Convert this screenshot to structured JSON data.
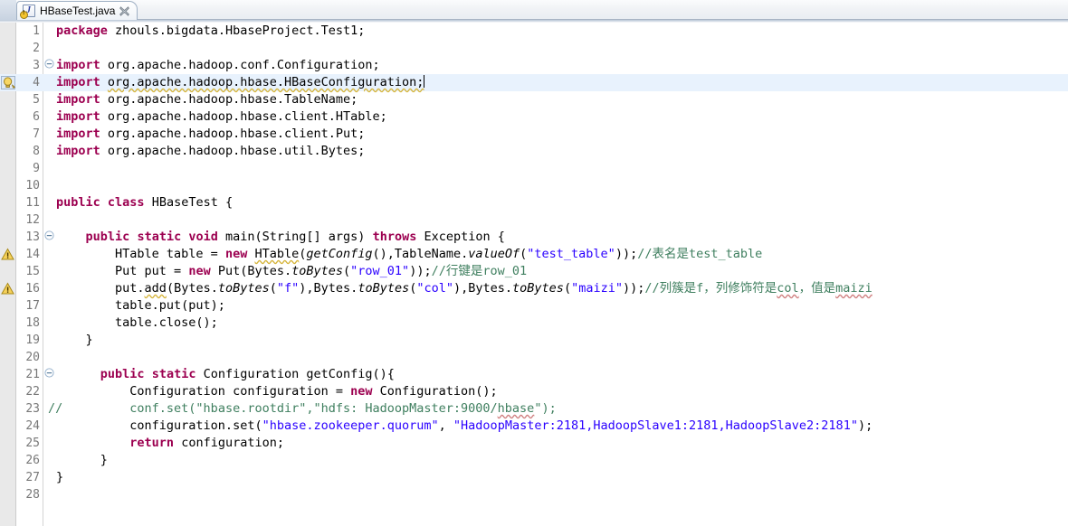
{
  "window": {
    "app": "Eclipse IDE - Java Editor"
  },
  "tab": {
    "label": "HBaseTest.java",
    "icon": "java-file-icon",
    "close_icon": "close-icon",
    "warning_badge": "warning-badge-icon"
  },
  "editor": {
    "current_line": 4,
    "colors": {
      "keyword": "#9c0050",
      "string": "#2a00ff",
      "comment": "#3f7f5f",
      "current_line_highlight": "#e8f2fd",
      "gutter": "#e9e9e9",
      "line_number": "#787878",
      "background": "#ffffff"
    },
    "lines": [
      {
        "no": "1",
        "fold": "",
        "marker": "",
        "html": "<span class=\"kw\">package</span> zhouls.bigdata.HbaseProject.Test1;"
      },
      {
        "no": "2",
        "fold": "",
        "marker": "",
        "html": ""
      },
      {
        "no": "3",
        "fold": "minus",
        "marker": "",
        "html": "<span class=\"kw\">import</span> org.apache.hadoop.conf.Configuration;"
      },
      {
        "no": "4",
        "fold": "",
        "marker": "bulb",
        "current": true,
        "html": "<span class=\"kw\">import</span> <span class=\"warnsq\">org.apache.hadoop.hbase.HBaseConfiguration;</span><span class=\"caret\"></span>"
      },
      {
        "no": "5",
        "fold": "",
        "marker": "",
        "html": "<span class=\"kw\">import</span> org.apache.hadoop.hbase.TableName;"
      },
      {
        "no": "6",
        "fold": "",
        "marker": "",
        "html": "<span class=\"kw\">import</span> org.apache.hadoop.hbase.client.HTable;"
      },
      {
        "no": "7",
        "fold": "",
        "marker": "",
        "html": "<span class=\"kw\">import</span> org.apache.hadoop.hbase.client.Put;"
      },
      {
        "no": "8",
        "fold": "",
        "marker": "",
        "html": "<span class=\"kw\">import</span> org.apache.hadoop.hbase.util.Bytes;"
      },
      {
        "no": "9",
        "fold": "",
        "marker": "",
        "html": ""
      },
      {
        "no": "10",
        "fold": "",
        "marker": "",
        "html": ""
      },
      {
        "no": "11",
        "fold": "",
        "marker": "",
        "html": "<span class=\"kw\">public</span> <span class=\"kw\">class</span> HBaseTest {"
      },
      {
        "no": "12",
        "fold": "",
        "marker": "",
        "html": ""
      },
      {
        "no": "13",
        "fold": "minus",
        "marker": "",
        "html": "    <span class=\"kw\">public</span> <span class=\"kw\">static</span> <span class=\"kw\">void</span> main(String[] args) <span class=\"kw\">throws</span> Exception {"
      },
      {
        "no": "14",
        "fold": "",
        "marker": "warn",
        "html": "        HTable table = <span class=\"kw\">new</span> <span class=\"deprec warnsq\">HTable</span>(<span class=\"stat\">getConfig</span>(),TableName.<span class=\"stat\">valueOf</span>(<span class=\"str\">\"test_table\"</span>));<span class=\"cmt\">//表名是test_table</span>"
      },
      {
        "no": "15",
        "fold": "",
        "marker": "",
        "html": "        Put put = <span class=\"kw\">new</span> Put(Bytes.<span class=\"stat\">toBytes</span>(<span class=\"str\">\"row_01\"</span>));<span class=\"cmt\">//行键是row_01</span>"
      },
      {
        "no": "16",
        "fold": "",
        "marker": "warn",
        "html": "        put.<span class=\"deprec warnsq\">add</span>(Bytes.<span class=\"stat\">toBytes</span>(<span class=\"str\">\"f\"</span>),Bytes.<span class=\"stat\">toBytes</span>(<span class=\"str\">\"col\"</span>),Bytes.<span class=\"stat\">toBytes</span>(<span class=\"str\">\"maizi\"</span>));<span class=\"cmt\">//列簇是f，列修饰符是<span class=\"spellsq\">col</span>，值是<span class=\"spellsq\">maizi</span></span>"
      },
      {
        "no": "17",
        "fold": "",
        "marker": "",
        "html": "        table.put(put);"
      },
      {
        "no": "18",
        "fold": "",
        "marker": "",
        "html": "        table.close();"
      },
      {
        "no": "19",
        "fold": "",
        "marker": "",
        "html": "    }"
      },
      {
        "no": "20",
        "fold": "",
        "marker": "",
        "html": ""
      },
      {
        "no": "21",
        "fold": "minus",
        "marker": "",
        "html": "      <span class=\"kw\">public</span> <span class=\"kw\">static</span> Configuration getConfig(){"
      },
      {
        "no": "22",
        "fold": "",
        "marker": "",
        "html": "          Configuration configuration = <span class=\"kw\">new</span> Configuration();"
      },
      {
        "no": "23",
        "fold": "",
        "marker": "",
        "prefix": "//",
        "html": "          <span class=\"cmtline\">conf.set(\"hbase.rootdir\",\"hdfs: HadoopMaster:9000/<span class=\"spellsq\">hbase</span>\");</span>"
      },
      {
        "no": "24",
        "fold": "",
        "marker": "",
        "html": "          configuration.set(<span class=\"str\">\"hbase.zookeeper.quorum\"</span>, <span class=\"str\">\"HadoopMaster:2181,HadoopSlave1:2181,HadoopSlave2:2181\"</span>);"
      },
      {
        "no": "25",
        "fold": "",
        "marker": "",
        "html": "          <span class=\"kw\">return</span> configuration;"
      },
      {
        "no": "26",
        "fold": "",
        "marker": "",
        "html": "      }"
      },
      {
        "no": "27",
        "fold": "",
        "marker": "",
        "html": "}"
      },
      {
        "no": "28",
        "fold": "",
        "marker": "",
        "html": ""
      }
    ]
  }
}
